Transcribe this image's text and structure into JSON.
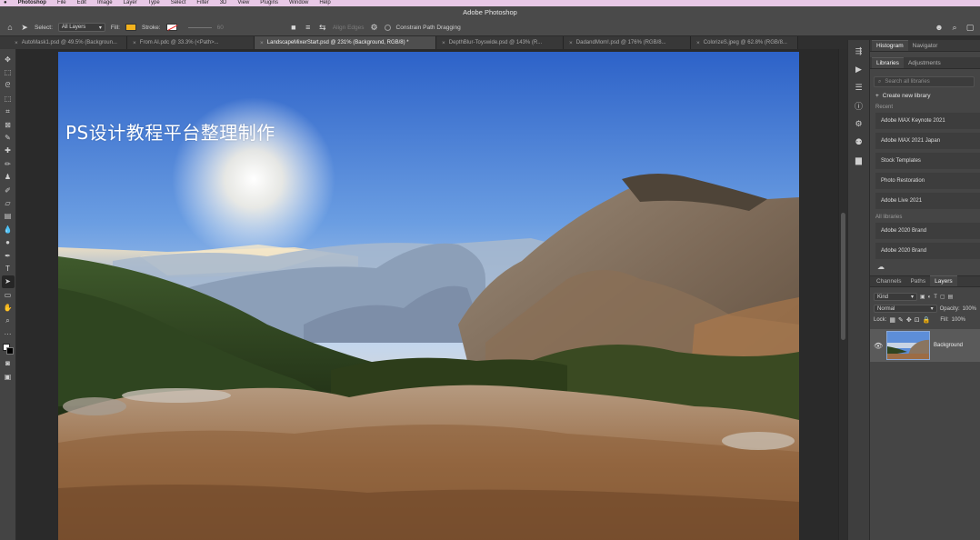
{
  "menubar": {
    "apple": "",
    "app_name": "Photoshop",
    "items": [
      "File",
      "Edit",
      "Image",
      "Layer",
      "Type",
      "Select",
      "Filter",
      "3D",
      "View",
      "Plugins",
      "Window",
      "Help"
    ]
  },
  "window": {
    "title": "Adobe Photoshop"
  },
  "options_bar": {
    "select_label": "Select:",
    "select_value": "All Layers",
    "fill_label": "Fill:",
    "stroke_label": "Stroke:",
    "stroke_width": "60",
    "align_edges": "Align Edges",
    "constrain_label": "Constrain Path Dragging",
    "fill_color": "#f2b21d"
  },
  "tabs": [
    {
      "label": "AutoMask1.psd @ 49.5% (Backgroun..."
    },
    {
      "label": "From AI.pdc @ 33.3% (<Path>..."
    },
    {
      "label": "LandscapeMixerStart.psd @ 231% (Background, RGB/8) *"
    },
    {
      "label": "DepthBlur-Toyswide.psd @ 143% (R..."
    },
    {
      "label": "DadandMom!.psd @ 176% (RGB/8..."
    },
    {
      "label": "ColorizeS.jpeg @ 62.8% (RGB/8..."
    }
  ],
  "active_tab_index": 2,
  "canvas": {
    "watermark": "PS设计教程平台整理制作"
  },
  "panels_top": {
    "tabs": [
      "Histogram",
      "Navigator"
    ],
    "lib_tabs": [
      "Libraries",
      "Adjustments"
    ],
    "search_placeholder": "Search all libraries",
    "create_label": "Create new library",
    "recent_label": "Recent",
    "recent_items": [
      "Adobe MAX Keynote 2021",
      "Adobe MAX 2021 Japan",
      "Stock Templates",
      "Photo Restoration",
      "Adobe Live 2021"
    ],
    "all_label": "All libraries",
    "all_items": [
      "Adobe 2020 Brand",
      "Adobe 2020 Brand"
    ]
  },
  "layers_panel": {
    "tabs": [
      "Channels",
      "Paths",
      "Layers"
    ],
    "kind_label": "Kind",
    "blend_mode": "Normal",
    "opacity_label": "Opacity:",
    "opacity_value": "100%",
    "lock_label": "Lock:",
    "fill_label": "Fill:",
    "fill_value": "100%",
    "layer_name": "Background"
  }
}
